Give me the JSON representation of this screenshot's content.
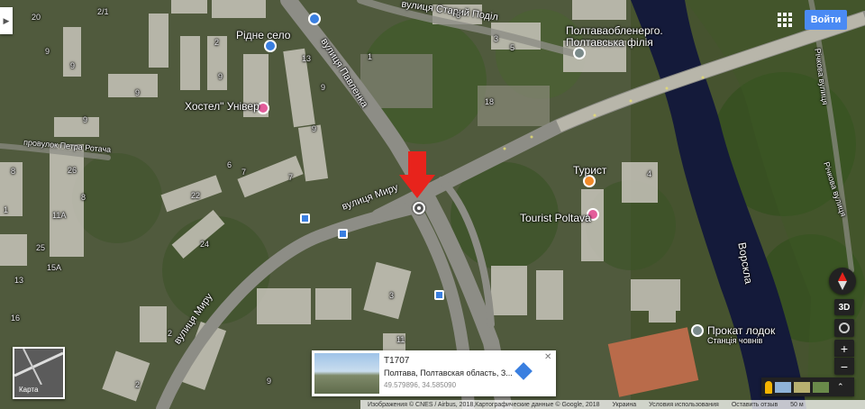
{
  "map": {
    "places": {
      "ridne_selo": "Рідне село",
      "hostel": "Хостел\" Універ",
      "poltavaoblenergo_1": "Полтаваобленерго.",
      "poltavaoblenergo_2": "Полтавська філія",
      "turyst": "Турист",
      "tourist_poltava": "Tourist Poltava",
      "prokat_1": "Прокат лодок",
      "prokat_2": "Станція човнів"
    },
    "streets": {
      "staryi_podil": "вулиця Старий Поділ",
      "pavlenka": "вулиця Павленка",
      "myru_1": "вулиця Миру",
      "myru_2": "вулиця Миру",
      "rotacha": "провулок Петра Ротача",
      "richkova_1": "Річкова вулиця",
      "richkova_2": "Річкова вулиця",
      "vorskla": "Ворскла"
    },
    "house_numbers": [
      "20",
      "2/1",
      "9",
      "2",
      "9",
      "3",
      "5",
      "6",
      "1",
      "13",
      "9",
      "9",
      "9",
      "9",
      "18",
      "7",
      "9",
      "26",
      "8",
      "1",
      "6",
      "22",
      "7",
      "24",
      "8",
      "11A",
      "15A",
      "13",
      "16",
      "25",
      "3",
      "2",
      "2",
      "11",
      "9",
      "4"
    ]
  },
  "header": {
    "login_label": "Войти",
    "apps_icon": "apps-grid-icon"
  },
  "controls": {
    "view_3d": "3D",
    "zoom_in": "+",
    "zoom_out": "−",
    "scale": "50 м"
  },
  "minimap": {
    "label": "Карта"
  },
  "info_card": {
    "title": "T1707",
    "address": "Полтава, Полтавская область, З...",
    "coords": "49.579896, 34.585090"
  },
  "footer": {
    "attribution": "Изображения © CNES / Airbus, 2018,Картографические данные © Google, 2018",
    "country": "Украина",
    "terms": "Условия использования",
    "feedback": "Оставить отзыв"
  },
  "colors": {
    "marker_red": "#e8231c",
    "login_blue": "#4a8af4",
    "pin_pink": "#e35d9a",
    "pin_orange": "#f08a2a",
    "pin_blue": "#3a7fe0",
    "pin_gray": "#7a8a8a",
    "river": "#141a3a"
  }
}
